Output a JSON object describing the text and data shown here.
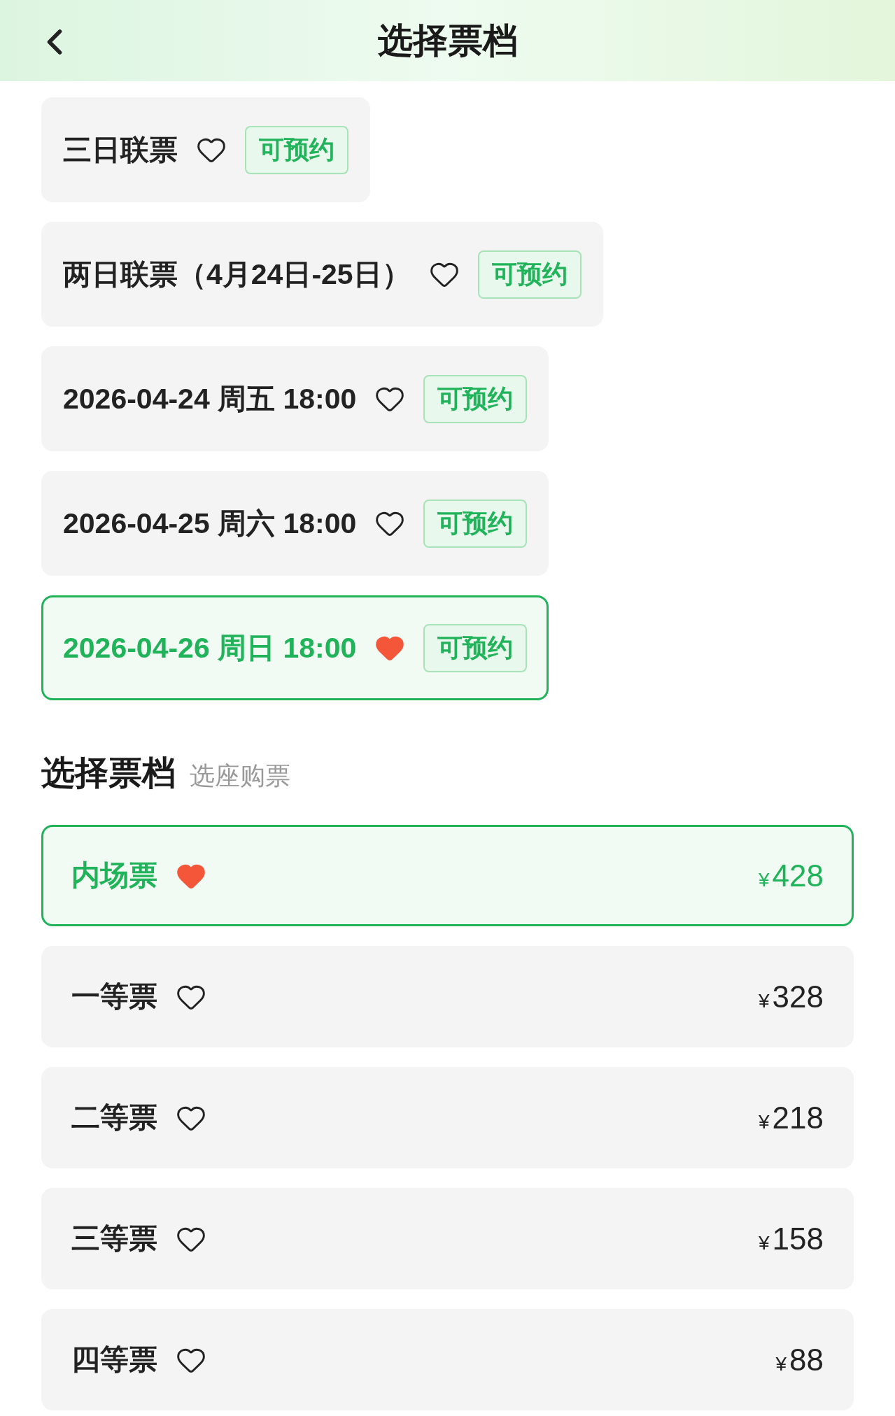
{
  "header": {
    "title": "选择票档"
  },
  "sessions": [
    {
      "label": "三日联票",
      "favorite": false,
      "selected": false,
      "badge": "可预约"
    },
    {
      "label": "两日联票（4月24日-25日）",
      "favorite": false,
      "selected": false,
      "badge": "可预约"
    },
    {
      "label": "2026-04-24 周五 18:00",
      "favorite": false,
      "selected": false,
      "badge": "可预约"
    },
    {
      "label": "2026-04-25 周六 18:00",
      "favorite": false,
      "selected": false,
      "badge": "可预约"
    },
    {
      "label": "2026-04-26 周日 18:00",
      "favorite": true,
      "selected": true,
      "badge": "可预约"
    }
  ],
  "tier_section": {
    "title": "选择票档",
    "subtitle": "选座购票"
  },
  "tiers": [
    {
      "name": "内场票",
      "favorite": true,
      "selected": true,
      "currency": "¥",
      "amount": "428"
    },
    {
      "name": "一等票",
      "favorite": false,
      "selected": false,
      "currency": "¥",
      "amount": "328"
    },
    {
      "name": "二等票",
      "favorite": false,
      "selected": false,
      "currency": "¥",
      "amount": "218"
    },
    {
      "name": "三等票",
      "favorite": false,
      "selected": false,
      "currency": "¥",
      "amount": "158"
    },
    {
      "name": "四等票",
      "favorite": false,
      "selected": false,
      "currency": "¥",
      "amount": "88"
    }
  ]
}
